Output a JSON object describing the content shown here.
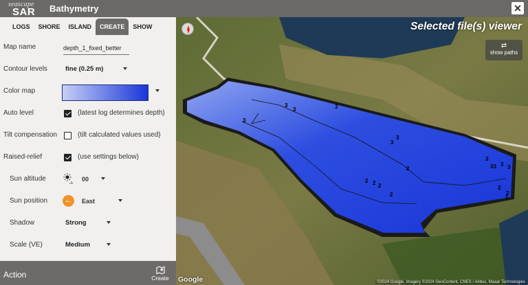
{
  "app": {
    "logo_line1": "seascape",
    "logo_line2": "SAR",
    "title": "Bathymetry",
    "close_glyph": "✕"
  },
  "tabs": [
    {
      "label": "LOGS",
      "active": false
    },
    {
      "label": "SHORE",
      "active": false
    },
    {
      "label": "ISLAND",
      "active": false
    },
    {
      "label": "CREATE",
      "active": true
    },
    {
      "label": "SHOW",
      "active": false
    }
  ],
  "form": {
    "map_name": {
      "label": "Map name",
      "value": "depth_1_fixed_better"
    },
    "contour_levels": {
      "label": "Contour levels",
      "value": "fine (0.25 m)"
    },
    "color_map": {
      "label": "Color map",
      "from_color": "#c6cff5",
      "to_color": "#1a36d8"
    },
    "auto_level": {
      "label": "Auto level",
      "checked": true,
      "note": "(latest log determines depth)"
    },
    "tilt_compensation": {
      "label": "Tilt compensation",
      "checked": false,
      "note": "(tilt calculated values used)"
    },
    "raised_relief": {
      "label": "Raised-relief",
      "checked": true,
      "note": "(use settings below)"
    },
    "sun_altitude": {
      "label": "Sun altitude",
      "value": "00",
      "icon": "sun-altitude-icon"
    },
    "sun_position": {
      "label": "Sun position",
      "value": "East",
      "icon": "arrow-left-icon"
    },
    "shadow": {
      "label": "Shadow",
      "value": "Strong"
    },
    "scale": {
      "label": "Scale (VE)",
      "value": "Medium"
    }
  },
  "action": {
    "label": "Action",
    "create_label": "Create",
    "create_icon": "map-pin-icon"
  },
  "map": {
    "viewer_title": "Selected file(s) viewer",
    "show_paths_label": "show paths",
    "show_paths_icon": "swap-arrows-icon",
    "google_label": "Google",
    "attribution": "©2024 Google, Imagery ©2024 GeoContent, CNES / Airbus, Maxar Technologies",
    "contour_labels": [
      "3",
      "3",
      "3",
      "3",
      "3",
      "3",
      "3",
      "33",
      "3",
      "3",
      "2",
      "2",
      "2",
      "2",
      "2",
      "2",
      "2",
      "1"
    ],
    "colors": {
      "deep": "#1a36d8",
      "shallow": "#8fa4f0",
      "water_dark": "#1f3a57",
      "land": "#6b7a3c"
    }
  }
}
